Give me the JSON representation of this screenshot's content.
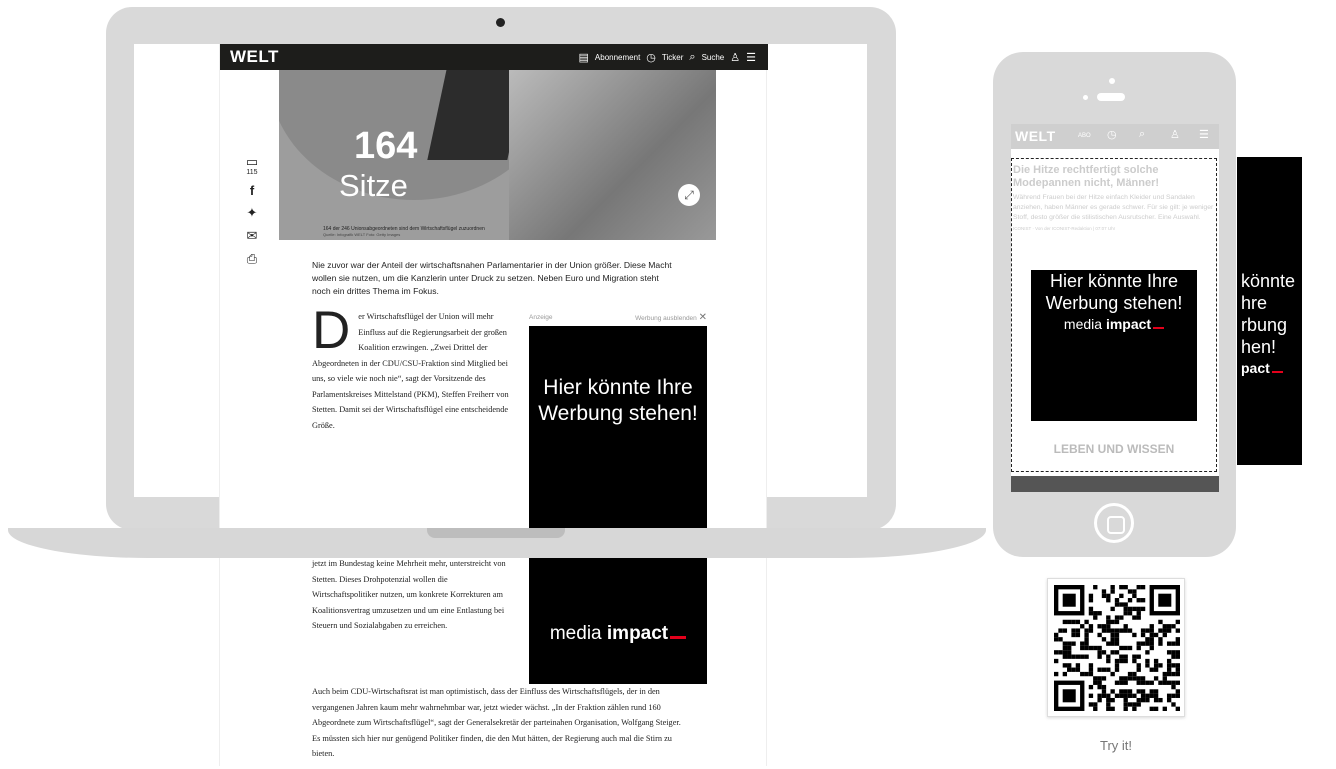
{
  "article": {
    "logo": "WELT",
    "nav": {
      "subscription": "Abonnement",
      "ticker": "Ticker",
      "search": "Suche"
    },
    "hero": {
      "number": "164",
      "label": "Sitze",
      "caption": "164 der 246 Unionsabgeordneten sind dem Wirtschaftsflügel zuzuordnen",
      "credit": "Quelle: Infografik WELT Foto: Getty Images"
    },
    "comment_count": "115",
    "lead": "Nie zuvor war der Anteil der wirtschaftsnahen Parlamentarier in der Union größer. Diese Macht wollen sie nutzen, um die Kanzlerin unter Druck zu setzen. Neben Euro und Migration steht noch ein drittes Thema im Fokus.",
    "dropcap": "D",
    "body": "er Wirtschaftsflügel der Union will mehr Einfluss auf die Regierungsarbeit der großen Koalition erzwingen. „Zwei Drittel der Abgeordneten in der CDU/CSU-Fraktion sind Mitglied bei uns, so viele wie noch nie“, sagt der Vorsitzende des Parlamentskreises Mittelstand (PKM), Steffen Freiherr von Stetten. Damit sei der Wirtschaftsflügel eine entscheidende Größe.",
    "body_lower": "jetzt im Bundestag keine Mehrheit mehr, unterstreicht von Stetten. Dieses Drohpotenzial wollen die Wirtschaftspolitiker nutzen, um konkrete Korrekturen am Koalitionsvertrag umzusetzen und um eine Entlastung bei Steuern und Sozialabgaben zu erreichen.",
    "body2": "Auch beim CDU-Wirtschaftsrat ist man optimistisch, dass der Einfluss des Wirtschaftsflügels, der in den vergangenen Jahren kaum mehr wahrnehmbar war, jetzt wieder wächst. „In der Fraktion zählen rund 160 Abgeordnete zum Wirtschaftsflügel“, sagt der Generalsekretär der parteinahen Organisation, Wolfgang Steiger. Es müssten sich hier nur genügend Politiker finden, die den Mut hätten, der Regierung auch mal die Stirn zu bieten."
  },
  "ad": {
    "label": "Anzeige",
    "hide": "Werbung ausblenden",
    "message": "Hier könnte Ihre Werbung stehen!",
    "brand_light": "media",
    "brand_bold": "impact",
    "brand_color": "#e3001b"
  },
  "phone": {
    "logo": "WELT",
    "abo": "ABO",
    "headline": "Die Hitze rechtfertigt solche Modepannen nicht, Männer!",
    "teaser": "Während Frauen bei der Hitze einfach Kleider und Sandalen anziehen, haben Männer es gerade schwer. Für sie gilt: je weniger Stoff, desto größer die stilistischen Ausrutscher. Eine Auswahl.",
    "meta": "ICONIST · Von der ICONIST-Redaktion | 07:07 Uhr",
    "section_button": "LEBEN UND WISSEN"
  },
  "side_ad": {
    "lines": [
      "könnte",
      "hre",
      "rbung",
      "hen!"
    ],
    "brand": "pact"
  },
  "qr": {
    "caption": "Try it!"
  }
}
